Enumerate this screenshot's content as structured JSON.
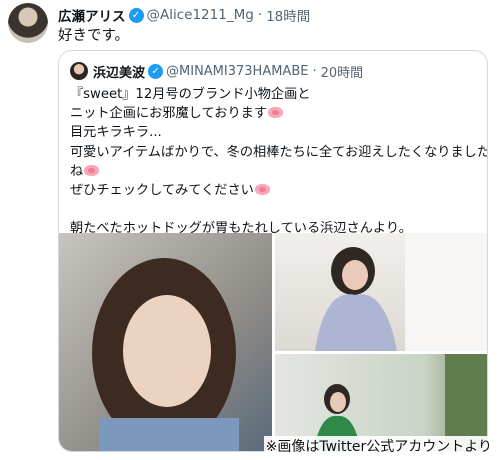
{
  "tweet": {
    "name": "広瀬アリス",
    "handle": "@Alice1211_Mg",
    "time": "18時間",
    "text": "好きです。"
  },
  "quoted": {
    "name": "浜辺美波",
    "handle": "@MINAMI373HAMABE",
    "time": "20時間",
    "lines": [
      "『sweet』12月号のブランド小物企画と",
      "ニット企画にお邪魔しております",
      "目元キラキラ...",
      "可愛いアイテムばかりで、冬の相棒たちに全てお迎えしたくなりました",
      "ね",
      "ぜひチェックしてみてください",
      "",
      "朝たべたホットドッグが胃もたれしている浜辺さんより。"
    ]
  },
  "footer_note": "※画像はTwitter公式アカウントより",
  "colors": {
    "verified": "#1d9bf0",
    "muted": "#536471",
    "border": "#cfd9de"
  },
  "icons": [
    "verified-badge-icon",
    "pig-face-emoji"
  ]
}
